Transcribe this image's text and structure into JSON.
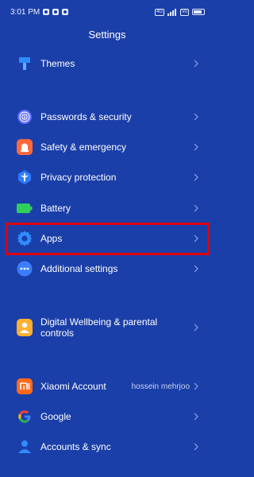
{
  "status_bar": {
    "time": "3:01 PM",
    "sim_label": "4G",
    "signal_label": "Vo"
  },
  "header": {
    "title": "Settings"
  },
  "items": [
    {
      "label": "Themes",
      "icon": "brush-icon",
      "color": "#2f8cff"
    },
    {
      "label": "Passwords & security",
      "icon": "fingerprint-icon",
      "color": "#5b6cff"
    },
    {
      "label": "Safety & emergency",
      "icon": "sos-icon",
      "color": "#ff6a3c"
    },
    {
      "label": "Privacy protection",
      "icon": "shield-icon",
      "color": "#2d7bff"
    },
    {
      "label": "Battery",
      "icon": "battery-icon",
      "color": "#2fd05a"
    },
    {
      "label": "Apps",
      "icon": "gear-icon",
      "color": "#2f8cff"
    },
    {
      "label": "Additional settings",
      "icon": "more-dots-icon",
      "color": "#3d7dff"
    },
    {
      "label": "Digital Wellbeing & parental controls",
      "icon": "wellbeing-icon",
      "color": "#ffb12f"
    },
    {
      "label": "Xiaomi Account",
      "value": "hossein mehrjoo",
      "icon": "mi-logo-icon",
      "color": "#ff6a1a"
    },
    {
      "label": "Google",
      "icon": "google-icon",
      "color": "#ffffff"
    },
    {
      "label": "Accounts & sync",
      "icon": "person-icon",
      "color": "#2f8cff"
    }
  ],
  "highlight": {
    "target": "Apps",
    "color": "#e00011"
  }
}
